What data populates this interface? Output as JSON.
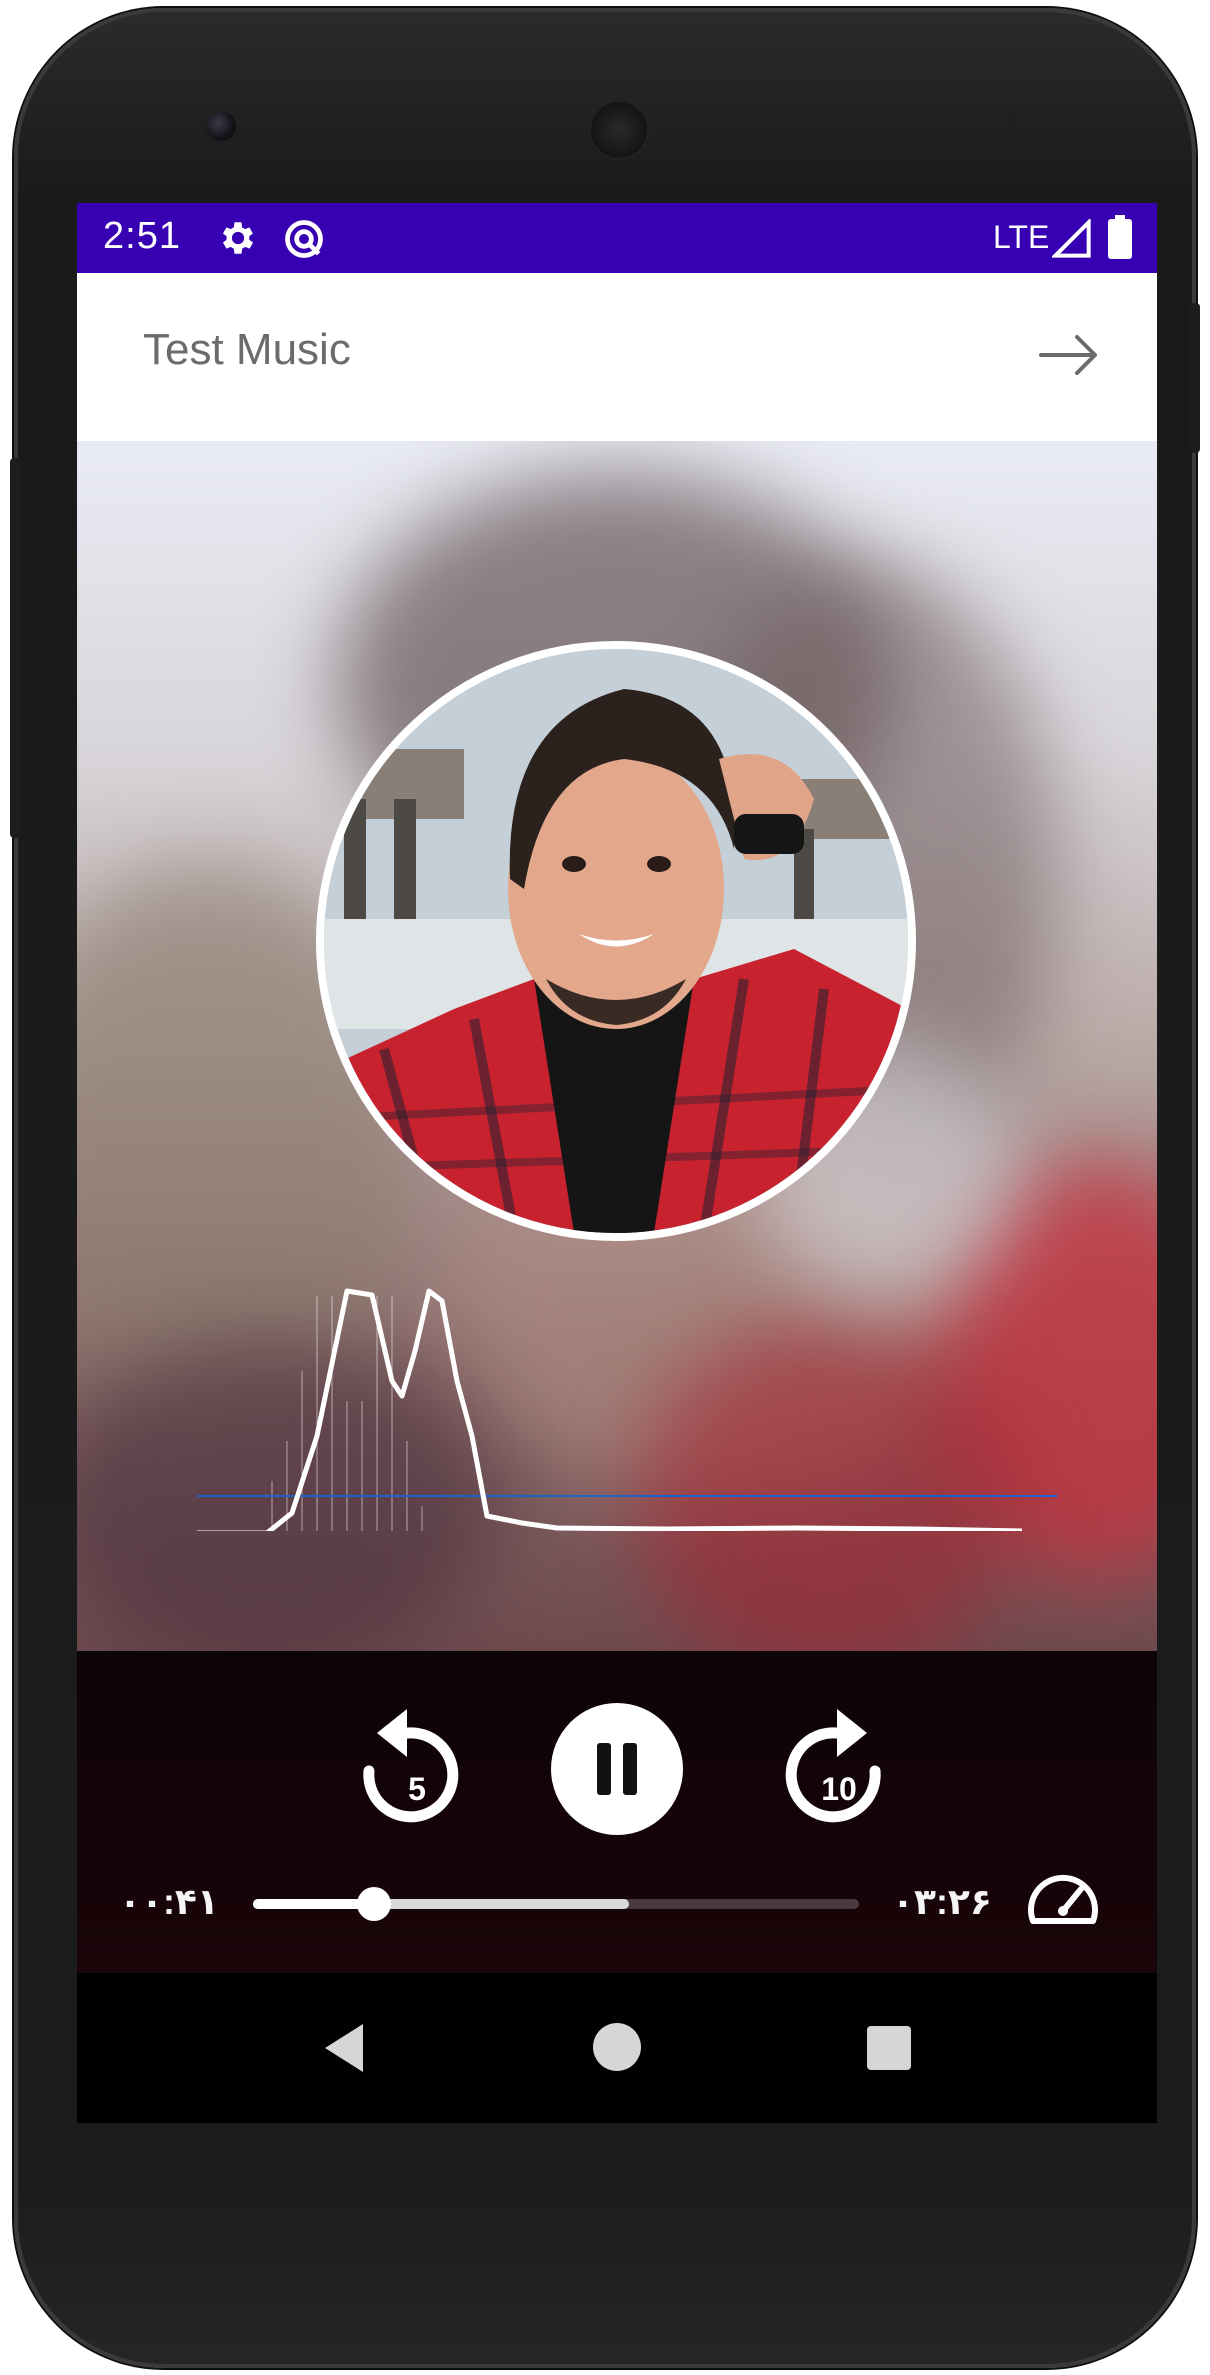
{
  "status_bar": {
    "time": "2:51",
    "network": "LTE",
    "icons": [
      "settings-icon",
      "sync-icon",
      "signal-icon",
      "battery-icon"
    ]
  },
  "app_bar": {
    "title": "Test Music",
    "forward_icon": "arrow-right-icon"
  },
  "player": {
    "elapsed": "۰۰:۴۱",
    "duration": "۰۳:۲۶",
    "rewind_seconds": "5",
    "forward_seconds": "10",
    "progress_fraction": 0.2,
    "buffered_fraction": 0.62,
    "icons": [
      "replay-5-icon",
      "pause-icon",
      "forward-10-icon",
      "speed-icon"
    ]
  },
  "nav_bar": {
    "icons": [
      "back-icon",
      "home-icon",
      "recents-icon"
    ]
  },
  "colors": {
    "status_bar": "#3700b3",
    "app_bar": "#ffffff",
    "player_bg": "#120407",
    "visualizer_baseline": "#1e62c9"
  }
}
